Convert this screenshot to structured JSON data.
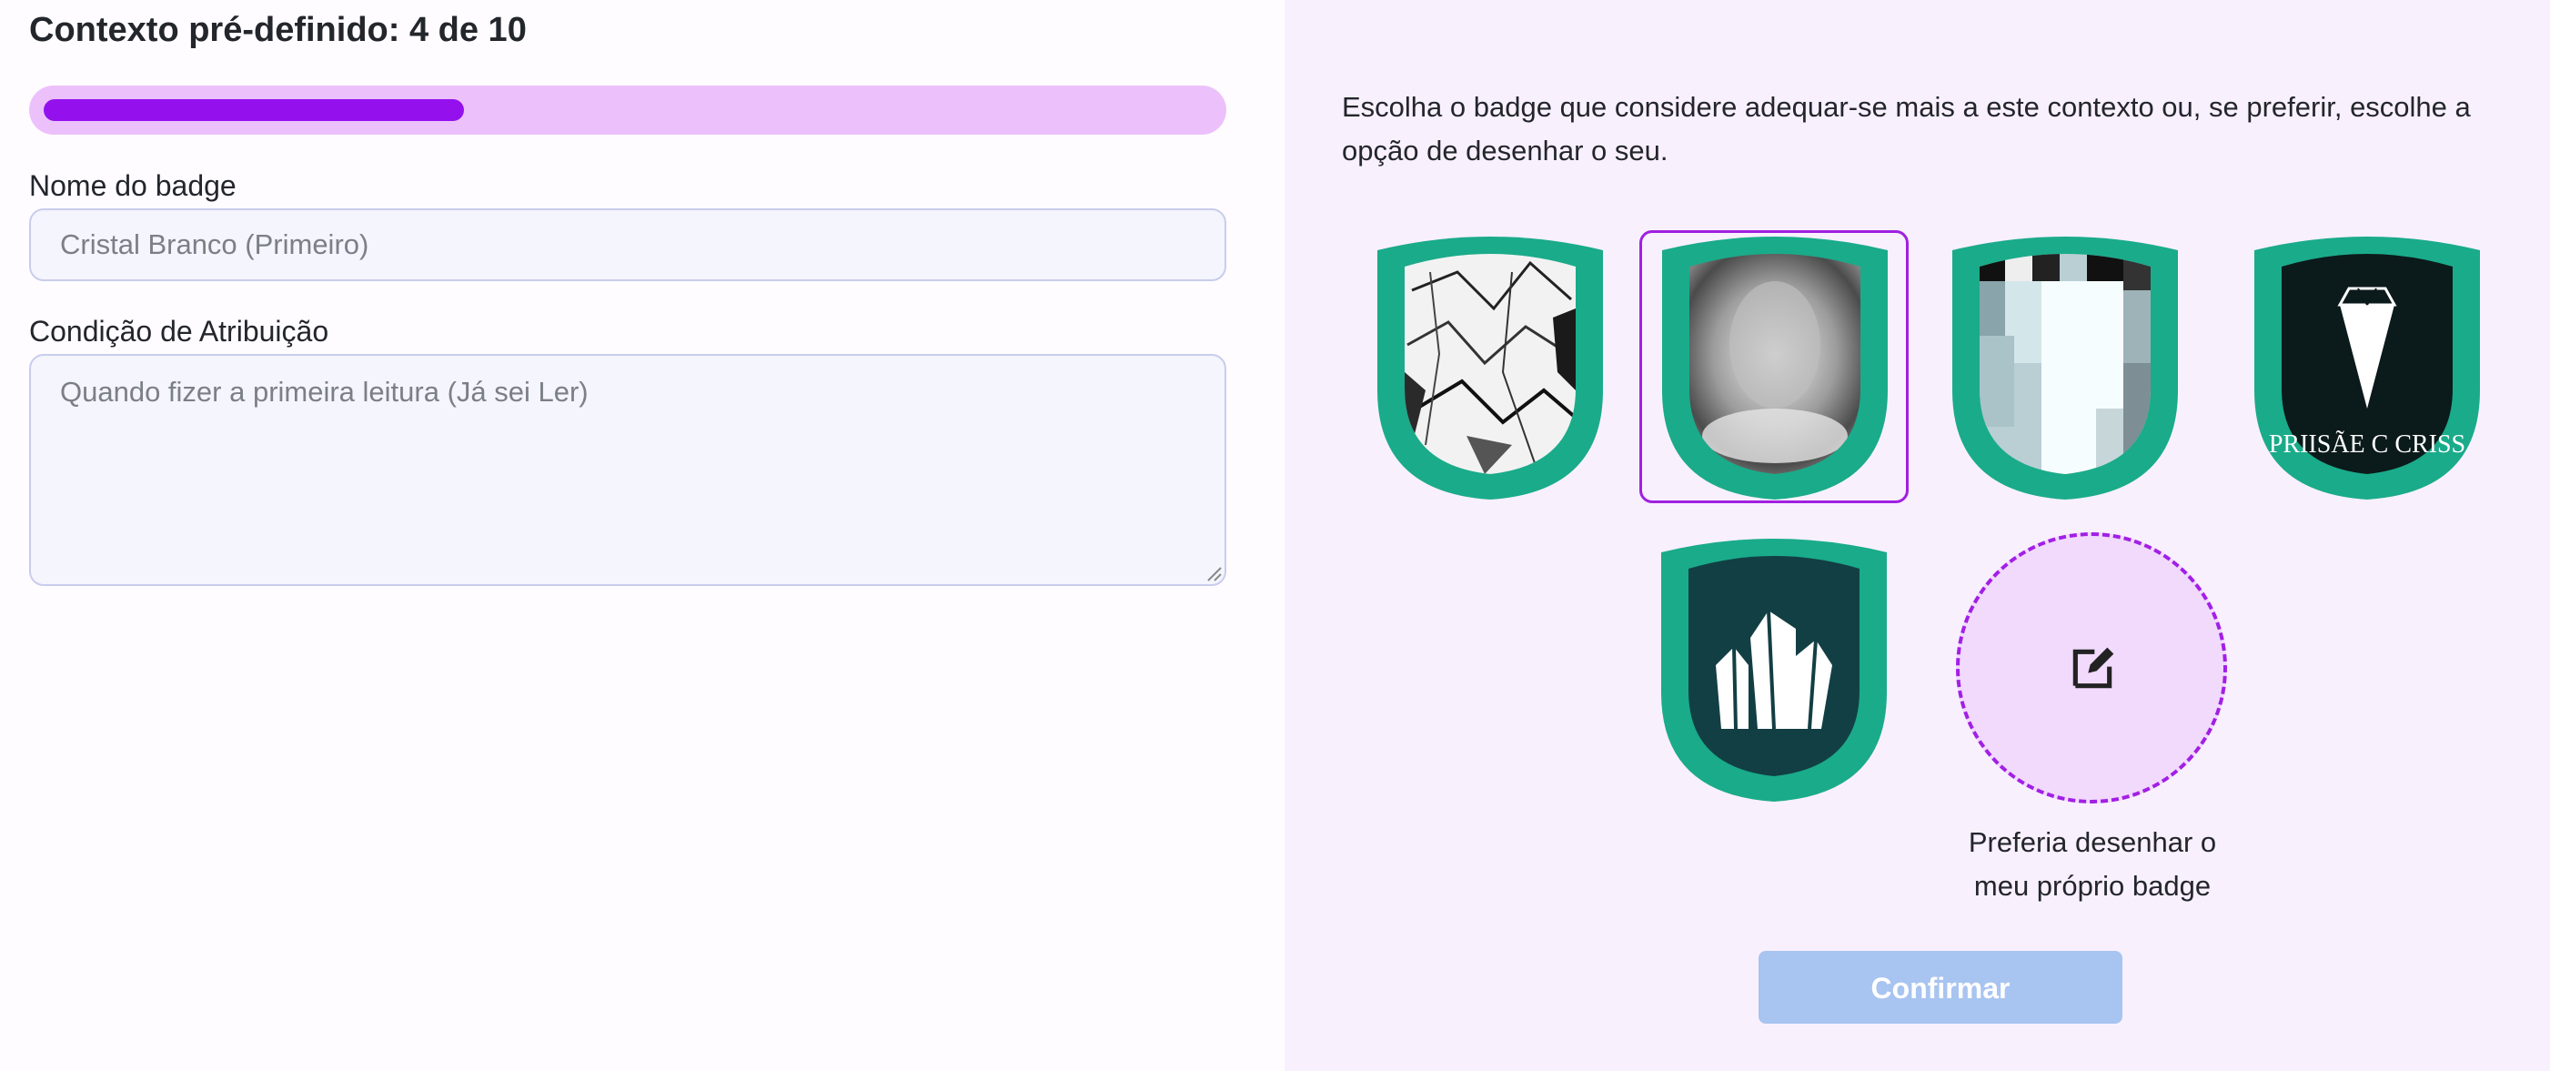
{
  "header": {
    "title": "Contexto pré-definido: 4 de 10",
    "progress_fraction": 0.36
  },
  "form": {
    "name_label": "Nome do badge",
    "name_value": "Cristal Branco (Primeiro)",
    "condition_label": "Condição de Atribuição",
    "condition_value": "Quando fizer a primeira leitura (Já sei Ler)"
  },
  "chooser": {
    "instructions": "Escolha o badge que considere adequar-se mais a este contexto ou, se preferir, escolhe a opção de desenhar o seu.",
    "badges": [
      {
        "id": "crumpled-crystal",
        "selected": false
      },
      {
        "id": "smooth-crystal",
        "selected": true
      },
      {
        "id": "pixel-crystal",
        "selected": false
      },
      {
        "id": "diamond-logo",
        "selected": false,
        "logo_text": "PRIISÃE C CRISS"
      },
      {
        "id": "crystal-cluster",
        "selected": false
      }
    ],
    "draw_own_label": "Preferia desenhar o meu próprio badge",
    "confirm_label": "Confirmar"
  },
  "colors": {
    "accent": "#9411ee",
    "progress_track": "#ecc1fb",
    "badge_frame": "#1aab8a",
    "confirm_disabled": "#a8c4f0",
    "panel_bg": "#f9f0fe"
  }
}
